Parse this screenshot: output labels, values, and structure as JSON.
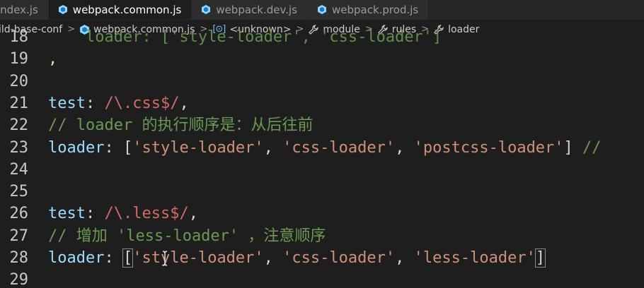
{
  "tabs": [
    {
      "label": "index.js",
      "icon": "js-file-icon",
      "active": false
    },
    {
      "label": "webpack.common.js",
      "icon": "webpack-icon",
      "active": true
    },
    {
      "label": "webpack.dev.js",
      "icon": "webpack-icon",
      "active": false
    },
    {
      "label": "webpack.prod.js",
      "icon": "webpack-icon",
      "active": false
    }
  ],
  "breadcrumb": {
    "folder": "ild-base-conf",
    "file": "webpack.common.js",
    "unknown": "<unknown>",
    "module": "module",
    "rules": "rules",
    "loader": "loader",
    "separator": ">",
    "symbol_glyph": "[⊙]"
  },
  "editor": {
    "lines": [
      {
        "num": "18",
        "parts": [
          {
            "t": "    loader: ['style-loader', 'css-loader']",
            "c": "faded"
          }
        ]
      },
      {
        "num": "19",
        "parts": [
          {
            "t": ",",
            "c": "y"
          }
        ]
      },
      {
        "num": "20",
        "parts": []
      },
      {
        "num": "21",
        "parts": [
          {
            "t": "test",
            "c": "k"
          },
          {
            "t": ": ",
            "c": "p"
          },
          {
            "t": "/\\.css$/",
            "c": "r"
          },
          {
            "t": ",",
            "c": "p"
          }
        ]
      },
      {
        "num": "22",
        "parts": [
          {
            "t": "// loader 的执行顺序是：从后往前",
            "c": "c"
          }
        ]
      },
      {
        "num": "23",
        "parts": [
          {
            "t": "loader",
            "c": "k"
          },
          {
            "t": ": [",
            "c": "p"
          },
          {
            "t": "'style-loader'",
            "c": "s"
          },
          {
            "t": ", ",
            "c": "p"
          },
          {
            "t": "'css-loader'",
            "c": "s"
          },
          {
            "t": ", ",
            "c": "p"
          },
          {
            "t": "'postcss-loader'",
            "c": "s"
          },
          {
            "t": "] ",
            "c": "p"
          },
          {
            "t": "//",
            "c": "c"
          }
        ]
      },
      {
        "num": "24",
        "parts": []
      },
      {
        "num": "25",
        "parts": []
      },
      {
        "num": "26",
        "parts": [
          {
            "t": "test",
            "c": "k"
          },
          {
            "t": ": ",
            "c": "p"
          },
          {
            "t": "/\\.less$/",
            "c": "r"
          },
          {
            "t": ",",
            "c": "p"
          }
        ]
      },
      {
        "num": "27",
        "parts": [
          {
            "t": "// 增加 'less-loader' ，注意顺序",
            "c": "c"
          }
        ]
      },
      {
        "num": "28",
        "parts": [
          {
            "t": "loader",
            "c": "k"
          },
          {
            "t": ": ",
            "c": "p"
          },
          {
            "t": "[",
            "c": "p box"
          },
          {
            "t": "'style-loader'",
            "c": "s"
          },
          {
            "t": ", ",
            "c": "p"
          },
          {
            "t": "'css-loader'",
            "c": "s"
          },
          {
            "t": ", ",
            "c": "p"
          },
          {
            "t": "'less-loader'",
            "c": "s"
          },
          {
            "t": "]",
            "c": "p box"
          }
        ]
      },
      {
        "num": "29",
        "parts": []
      }
    ]
  },
  "colors": {
    "background": "#1e1e1e",
    "keyword": "#9cdcfe",
    "string": "#ce9178",
    "regex": "#d16969",
    "comment": "#6a9955"
  }
}
